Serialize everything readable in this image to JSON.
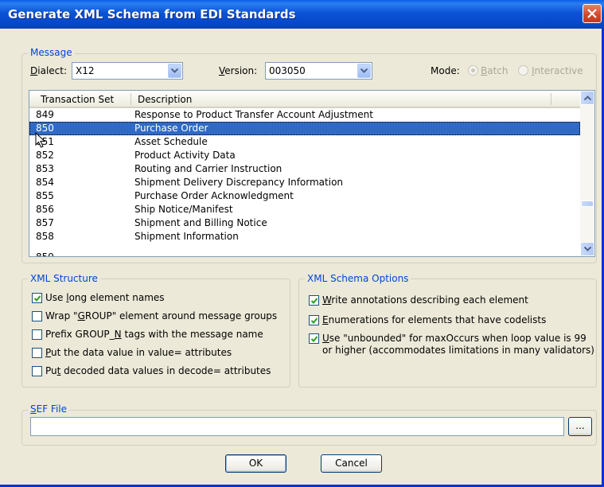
{
  "window": {
    "title": "Generate XML Schema from EDI Standards"
  },
  "message_group": {
    "label": "Message",
    "dialect_label": "Dialect:",
    "dialect_value": "X12",
    "version_label": "Version:",
    "version_value": "003050",
    "mode_label": "Mode:",
    "mode_batch": "Batch",
    "mode_interactive": "Interactive"
  },
  "list": {
    "headers": [
      "Transaction Set",
      "Description"
    ],
    "rows": [
      {
        "code": "849",
        "desc": "Response to Product Transfer Account Adjustment"
      },
      {
        "code": "850",
        "desc": "Purchase Order"
      },
      {
        "code": "851",
        "desc": "Asset Schedule"
      },
      {
        "code": "852",
        "desc": "Product Activity Data"
      },
      {
        "code": "853",
        "desc": "Routing and Carrier Instruction"
      },
      {
        "code": "854",
        "desc": "Shipment Delivery Discrepancy Information"
      },
      {
        "code": "855",
        "desc": "Purchase Order Acknowledgment"
      },
      {
        "code": "856",
        "desc": "Ship Notice/Manifest"
      },
      {
        "code": "857",
        "desc": "Shipment and Billing Notice"
      },
      {
        "code": "858",
        "desc": "Shipment Information"
      }
    ],
    "selected_code": "850"
  },
  "xml_structure": {
    "label": "XML Structure",
    "options": [
      {
        "label": "Use long element names",
        "checked": true
      },
      {
        "label": "Wrap \"GROUP\" element around message groups",
        "checked": false
      },
      {
        "label": "Prefix GROUP_N tags with the message name",
        "checked": false
      },
      {
        "label": "Put the data value in value= attributes",
        "checked": false
      },
      {
        "label": "Put decoded data values in decode= attributes",
        "checked": false
      }
    ]
  },
  "schema_options": {
    "label": "XML Schema Options",
    "options": [
      {
        "label": "Write annotations describing each element",
        "checked": true
      },
      {
        "label": "Enumerations for elements that have codelists",
        "checked": true
      },
      {
        "label": "Use \"unbounded\" for maxOccurs when loop value is 99",
        "label2": "or higher (accommodates limitations in many validators)",
        "checked": true
      }
    ]
  },
  "sef": {
    "label": "SEF File",
    "value": "",
    "browse_label": "..."
  },
  "buttons": {
    "ok": "OK",
    "cancel": "Cancel"
  },
  "colors": {
    "title_bar": "#0a53d6",
    "selection": "#316ac5",
    "group_label": "#0046d5",
    "dialog_bg": "#ece9d8"
  }
}
